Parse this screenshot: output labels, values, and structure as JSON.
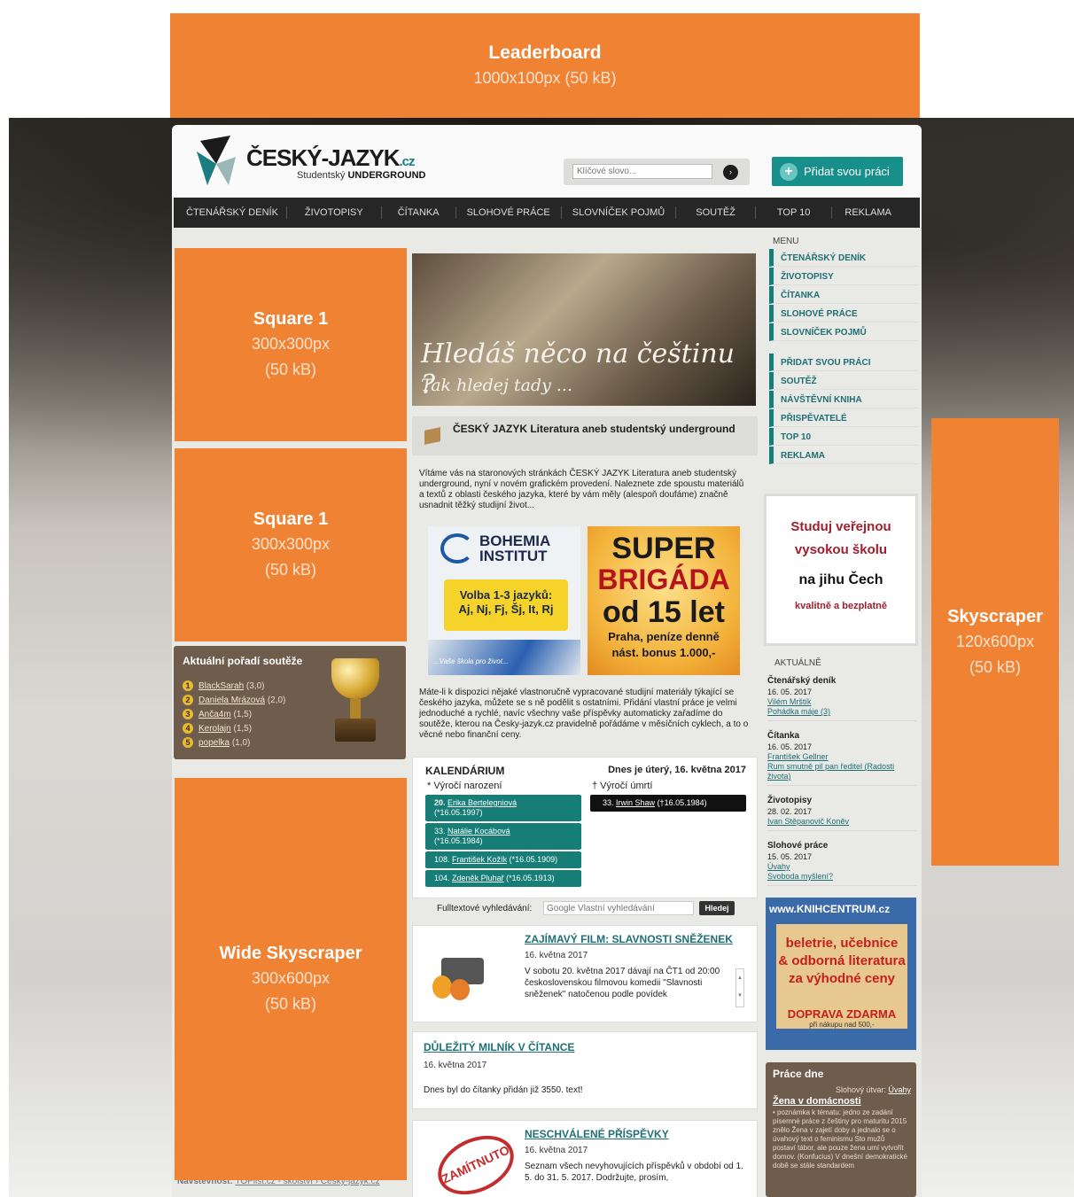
{
  "ads": {
    "leaderboard": {
      "title": "Leaderboard",
      "size": "1000x100px (50 kB)"
    },
    "square1": {
      "title": "Square 1",
      "size": "300x300px",
      "weight": "(50 kB)"
    },
    "square2": {
      "title": "Square 1",
      "size": "300x300px",
      "weight": "(50 kB)"
    },
    "wide_skyscraper": {
      "title": "Wide Skyscraper",
      "size": "300x600px",
      "weight": "(50 kB)"
    },
    "skyscraper": {
      "title": "Skyscraper",
      "size": "120x600px",
      "weight": "(50 kB)"
    },
    "color": "#ef8233"
  },
  "header": {
    "logo_main": "ČESKÝ-JAZYK",
    "logo_tld": ".cz",
    "logo_sub_prefix": "Studentský",
    "logo_sub_bold": "UNDERGROUND",
    "search_placeholder": "Klíčové slovo...",
    "search_go": "›",
    "add_button": "Přidat svou práci",
    "add_icon": "+"
  },
  "nav": [
    "ČTENÁŘSKÝ DENÍK",
    "ŽIVOTOPISY",
    "ČÍTANKA",
    "SLOHOVÉ PRÁCE",
    "SLOVNÍČEK POJMŮ",
    "SOUTĚŽ",
    "TOP 10",
    "REKLAMA"
  ],
  "banner": {
    "line1": "Hledáš něco na češtinu ?",
    "line2": "Tak hledej tady ..."
  },
  "welcome": {
    "title": "ČESKÝ JAZYK Literatura aneb studentský underground",
    "intro": "Vítáme vás na staronových stránkách ČESKÝ JAZYK Literatura aneb studentský underground, nyní v novém grafickém provedení. Naleznete zde spoustu materiálů a textů z oblasti českého jazyka, které by vám měly (alespoň doufáme) značně usnadnit těžký studijní život...",
    "para2": "Máte-li k dispozici nějaké vlastnoručně vypracované studijní materiály týkající se českého jazyka, můžete se s ně podělit s ostatními. Přidání vlastní práce je velmi jednoduché a rychlé, navíc všechny vaše příspěvky automaticky zařadíme do soutěže, kterou na Česky-jazyk.cz pravidelně pořádáme v měsíčních cyklech, a to o věcné nebo finanční ceny."
  },
  "bohemia": {
    "logo1": "BOHEMIA",
    "logo2": "INSTITUT",
    "box1": "Volba 1-3 jazyků:",
    "box2": "Aj, Nj, Fj, Šj, It, Rj",
    "slogan": "...Vaše škola pro život..."
  },
  "super": {
    "a": "SUPER",
    "b": "BRIGÁDA",
    "c": "od 15 let",
    "d": "Praha, peníze denně",
    "e": "nást. bonus 1.000,-"
  },
  "poradi": {
    "title": "Aktuální pořadí soutěže",
    "items": [
      {
        "n": "1",
        "name": "BlackSarah",
        "score": "(3,0)"
      },
      {
        "n": "2",
        "name": "Daniela Mrázová",
        "score": "(2,0)"
      },
      {
        "n": "3",
        "name": "Anča4m",
        "score": "(1,5)"
      },
      {
        "n": "4",
        "name": "Kerolajn",
        "score": "(1,5)"
      },
      {
        "n": "5",
        "name": "popelka",
        "score": "(1,0)"
      }
    ]
  },
  "kalendarium": {
    "title": "KALENDÁRIUM",
    "date": "Dnes je úterý, 16. května 2017",
    "born_label": "* Výročí narození",
    "died_label": "† Výročí úmrtí",
    "born": [
      {
        "n": "20.",
        "name": "Erika Bertelegniová",
        "d": "(*16.05.1997)"
      },
      {
        "n": "33.",
        "name": "Natálie Kocábová",
        "d": "(*16.05.1984)"
      },
      {
        "n": "108.",
        "name": "František Kožík",
        "d": "(*16.05.1909)"
      },
      {
        "n": "104.",
        "name": "Zdeněk Pluhař",
        "d": "(*16.05.1913)"
      }
    ],
    "died": {
      "n": "33.",
      "name": "Irwin Shaw",
      "d": "(†16.05.1984)"
    }
  },
  "fulltext": {
    "label": "Fulltextové vyhledávání:",
    "placeholder": "Google Vlastní vyhledávání",
    "button": "Hledej"
  },
  "news": [
    {
      "title": "ZAJÍMAVÝ FILM: SLAVNOSTI SNĚŽENEK",
      "date": "16. května 2017",
      "text": "V sobotu 20. května 2017 dávají na ČT1 od 20:00 československou filmovou komedii \"Slavnosti sněženek\" natočenou podle povídek"
    },
    {
      "title": "DŮLEŽITÝ MILNÍK V ČÍTANCE",
      "date": "16. května 2017",
      "text": "Dnes byl do čítanky přidán již 3550. text!"
    },
    {
      "title": "NESCHVÁLENÉ PŘÍSPĚVKY",
      "date": "16. května 2017",
      "text": "Seznam všech nevyhovujících příspěvků v období od 1. 5. do 31. 5. 2017. Dodržujte, prosím,",
      "stamp": "ZAMÍTNUTO"
    }
  ],
  "menu": {
    "label": "MENU",
    "items1": [
      "ČTENÁŘSKÝ DENÍK",
      "ŽIVOTOPISY",
      "ČÍTANKA",
      "SLOHOVÉ PRÁCE",
      "SLOVNÍČEK POJMŮ"
    ],
    "items2": [
      "PŘIDAT SVOU PRÁCI",
      "SOUTĚŽ",
      "NÁVŠTĚVNÍ KNIHA",
      "PŘISPĚVATELÉ",
      "TOP 10",
      "REKLAMA"
    ]
  },
  "vsb": {
    "a1": "Studuj veřejnou",
    "a2": "vysokou školu",
    "b": "na jihu Čech",
    "c": "kvalitně a bezplatně"
  },
  "aktualne": {
    "label": "AKTUÁLNĚ",
    "groups": [
      {
        "title": "Čtenářský deník",
        "date": "16. 05. 2017",
        "l1": "Vilém Mrštík",
        "l2": "Pohádka máje (3)"
      },
      {
        "title": "Čítanka",
        "date": "16. 05. 2017",
        "l1": "František Gellner",
        "l2": "Rum smutně pil pan ředitel (Radosti života)"
      },
      {
        "title": "Životopisy",
        "date": "28. 02. 2017",
        "l1": "Ivan Stěpanovič Koněv",
        "l2": ""
      },
      {
        "title": "Slohové práce",
        "date": "15. 05. 2017",
        "l1": "Úvahy",
        "l2": "Svoboda myšlení?"
      }
    ]
  },
  "knihcentrum": {
    "head": "www.KNIHCENTRUM.cz",
    "line1": "beletrie, učebnice",
    "line2": "& odborná literatura",
    "line3": "za výhodné ceny",
    "dz": "DOPRAVA ZDARMA",
    "dz_small": "při nákupu nad 500,-"
  },
  "prace_dne": {
    "title": "Práce dne",
    "utvar": "Slohový útvar:",
    "utvar_link": "Úvahy",
    "item": "Žena v domácnosti",
    "text": "• poznámka k tématu: jedno ze zadání písemné práce z češtiny pro maturitu 2015 znělo Žena v zajetí doby a jednalo se o úvahový text o feminismu Sto mužů postaví tábor, ale pouze žena umí vytvořit domov. (Konfucius) V dnešní demokratické době se stále standardem"
  },
  "footer": {
    "label": "Návštěvnost:",
    "link": "TOPlist.cz - školství › Česky-jazyk.cz"
  }
}
